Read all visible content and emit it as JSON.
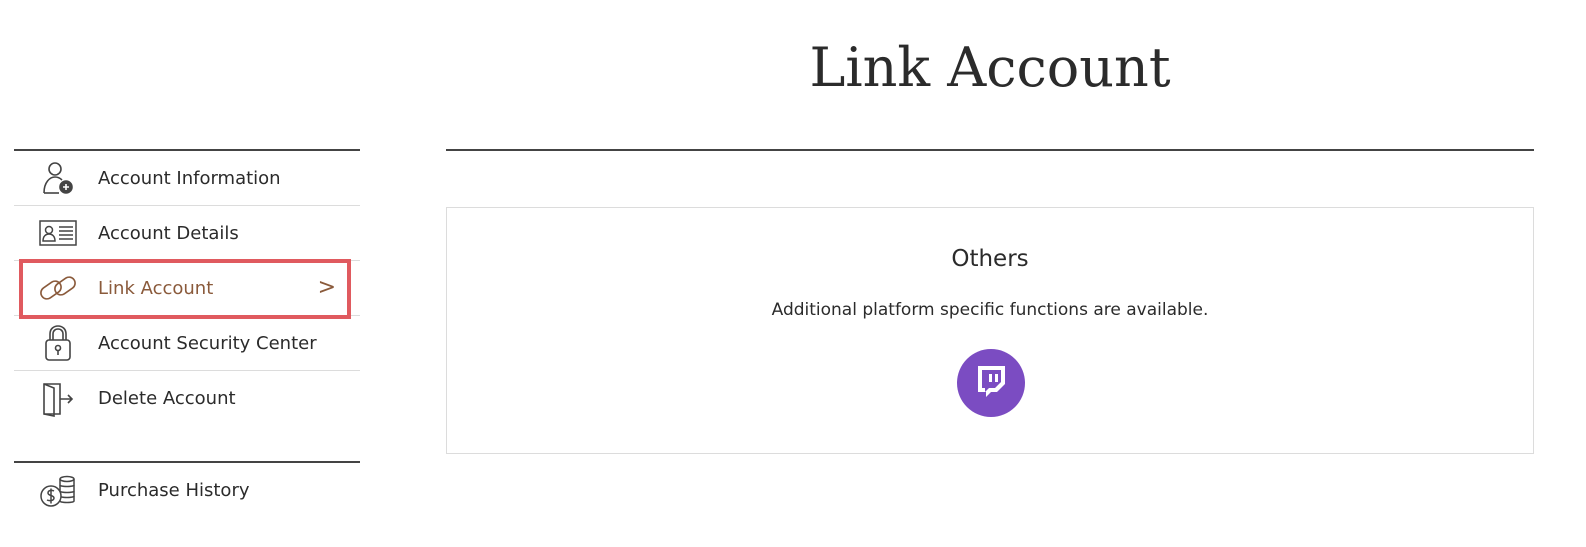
{
  "page": {
    "title": "Link Account"
  },
  "sidebar": {
    "items": [
      {
        "label": "Account Information",
        "icon": "user-add-icon"
      },
      {
        "label": "Account Details",
        "icon": "id-card-icon"
      },
      {
        "label": "Link Account",
        "icon": "link-icon",
        "active": true
      },
      {
        "label": "Account Security Center",
        "icon": "padlock-icon"
      },
      {
        "label": "Delete Account",
        "icon": "exit-door-icon"
      }
    ],
    "secondary_items": [
      {
        "label": "Purchase History",
        "icon": "coins-icon"
      }
    ],
    "active_chevron": ">"
  },
  "panel": {
    "heading": "Others",
    "description": "Additional platform specific functions are available.",
    "platform_button_icon": "twitch-icon"
  },
  "colors": {
    "active_text": "#8a5a3b",
    "highlight_border": "#e05a5f",
    "twitch_purple": "#7b4cc2",
    "rule": "#444444"
  }
}
